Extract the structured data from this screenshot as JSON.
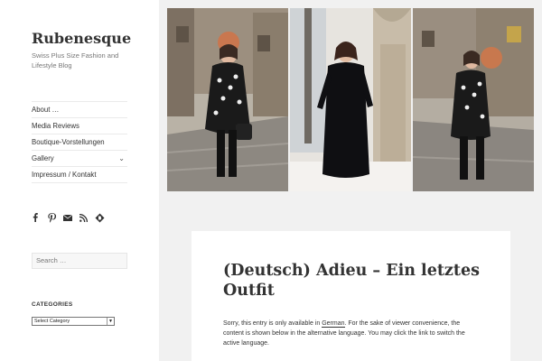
{
  "site": {
    "title": "Rubenesque",
    "description": "Swiss Plus Size Fashion and Lifestyle Blog"
  },
  "nav": {
    "items": [
      {
        "label": "About …"
      },
      {
        "label": "Media Reviews"
      },
      {
        "label": "Boutique-Vorstellungen"
      },
      {
        "label": "Gallery"
      },
      {
        "label": "Impressum / Kontakt"
      }
    ],
    "gallery_toggle": "⌄"
  },
  "social": [
    "facebook-icon",
    "pinterest-icon",
    "mail-icon",
    "rss-icon",
    "bloglovin-icon"
  ],
  "search": {
    "placeholder": "Search …"
  },
  "categories": {
    "title": "CATEGORIES",
    "select_value": "Select Category"
  },
  "post": {
    "title": "(Deutsch) Adieu – Ein letztes Outfit",
    "notice_before": "Sorry, this entry is only available in ",
    "notice_link": "German",
    "notice_after": ". For the sake of viewer convenience, the content is shown below in the alternative language. You may click the link to switch the active language."
  },
  "colors": {
    "background": "#f1f1f1",
    "sidebar": "#ffffff",
    "text": "#333333",
    "muted": "#777777"
  }
}
